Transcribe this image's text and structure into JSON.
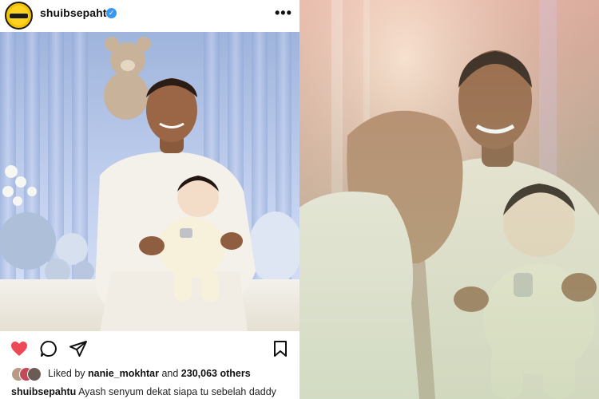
{
  "post": {
    "username": "shuibsepahtu",
    "verified": true,
    "avatar_icon": "brand-logo-avatar",
    "more_icon": "more-horizontal-icon",
    "more_label": "•••",
    "actions": {
      "like_icon": "heart-filled-icon",
      "comment_icon": "comment-bubble-icon",
      "share_icon": "send-icon",
      "save_icon": "bookmark-icon",
      "like_color": "#ed4956"
    },
    "likes": {
      "prefix": "Liked by",
      "user": "nanie_mokhtar",
      "middle": "and",
      "count": "230,063 others"
    },
    "caption": {
      "user": "shuibsepahtu",
      "text": "Ayash senyum dekat siapa tu sebelah daddy"
    }
  },
  "colors": {
    "verified_blue": "#3897f0",
    "avatar_yellow": "#f2c200",
    "right_photo_tint": "#e9b7a8"
  }
}
